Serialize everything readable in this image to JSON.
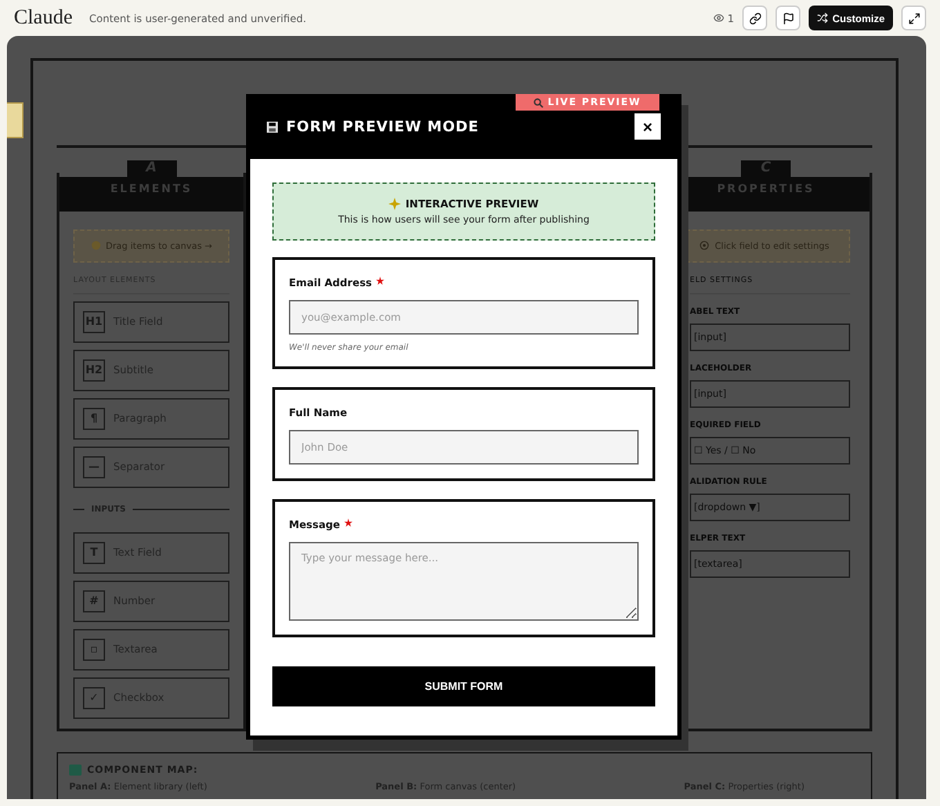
{
  "topbar": {
    "brand": "Claude",
    "notice": "Content is user-generated and unverified.",
    "views": "1",
    "customize": "Customize"
  },
  "builder": {
    "left_panel": {
      "letter": "A",
      "title": "ELEMENTS",
      "hint": "Drag items to canvas →",
      "sections": [
        {
          "kind": "heading",
          "title": "LAYOUT ELEMENTS",
          "items": [
            {
              "icon": "H1",
              "label": "Title Field"
            },
            {
              "icon": "H2",
              "label": "Subtitle"
            },
            {
              "icon": "¶",
              "label": "Paragraph"
            },
            {
              "icon": "—",
              "label": "Separator"
            }
          ]
        },
        {
          "kind": "divider",
          "title": "INPUTS",
          "items": [
            {
              "icon": "T",
              "label": "Text Field"
            },
            {
              "icon": "#",
              "label": "Number"
            },
            {
              "icon": "▫",
              "label": "Textarea"
            },
            {
              "icon": "✓",
              "label": "Checkbox"
            }
          ]
        }
      ]
    },
    "right_panel": {
      "letter": "C",
      "title": "PROPERTIES",
      "hint": "Click field to edit settings",
      "heading": "ELD SETTINGS",
      "fields": [
        {
          "label": "ABEL TEXT",
          "value": "[input]"
        },
        {
          "label": "LACEHOLDER",
          "value": "[input]"
        },
        {
          "label": "EQUIRED FIELD",
          "value": "☐ Yes / ☐ No"
        },
        {
          "label": "ALIDATION RULE",
          "value": "[dropdown ▼]"
        },
        {
          "label": "ELPER TEXT",
          "value": "[textarea]"
        }
      ]
    },
    "component_map": {
      "title": "COMPONENT MAP:",
      "items": [
        "**Panel A:** Element library (left)",
        "**Panel B:** Form canvas (center)",
        "**Panel C:** Properties (right)"
      ]
    }
  },
  "modal": {
    "badge": "LIVE PREVIEW",
    "title": "FORM PREVIEW MODE",
    "close": "×",
    "banner_title": "INTERACTIVE PREVIEW",
    "banner_text": "This is how users will see your form after publishing",
    "fields": [
      {
        "kind": "input",
        "label": "Email Address",
        "required": true,
        "placeholder": "you@example.com",
        "helper": "We'll never share your email"
      },
      {
        "kind": "input",
        "label": "Full Name",
        "required": false,
        "placeholder": "John Doe"
      },
      {
        "kind": "textarea",
        "label": "Message",
        "required": true,
        "placeholder": "Type your message here..."
      }
    ],
    "submit": "SUBMIT FORM"
  }
}
